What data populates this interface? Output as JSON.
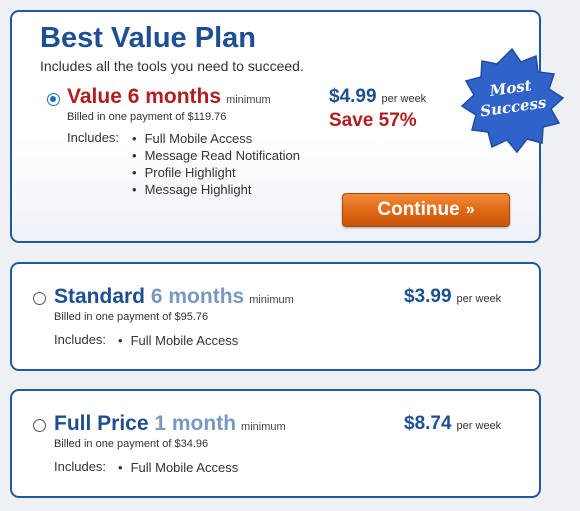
{
  "header": {
    "title": "Best Value Plan",
    "subtitle": "Includes all the tools you need to succeed."
  },
  "badge": {
    "line1": "Most",
    "line2": "Success"
  },
  "plans": [
    {
      "selected": true,
      "name": "Value",
      "duration": "6 months",
      "minimum": "minimum",
      "billed": "Billed in one payment of $119.76",
      "price": "$4.99",
      "per": "per week",
      "save": "Save 57%",
      "includes_label": "Includes:",
      "features": [
        "Full Mobile Access",
        "Message Read Notification",
        "Profile Highlight",
        "Message Highlight"
      ],
      "button": "Continue",
      "button_icon": "»"
    },
    {
      "selected": false,
      "name": "Standard",
      "duration": "6 months",
      "minimum": "minimum",
      "billed": "Billed in one payment of $95.76",
      "price": "$3.99",
      "per": "per week",
      "includes_label": "Includes:",
      "features": [
        "Full Mobile Access"
      ]
    },
    {
      "selected": false,
      "name": "Full Price",
      "duration": "1 month",
      "minimum": "minimum",
      "billed": "Billed in one payment of $34.96",
      "price": "$8.74",
      "per": "per week",
      "includes_label": "Includes:",
      "features": [
        "Full Mobile Access"
      ]
    }
  ],
  "colors": {
    "brand_blue": "#1f4f93",
    "accent_red": "#b01e1e",
    "button_orange": "#e06a14",
    "badge_blue": "#2f63c9"
  }
}
